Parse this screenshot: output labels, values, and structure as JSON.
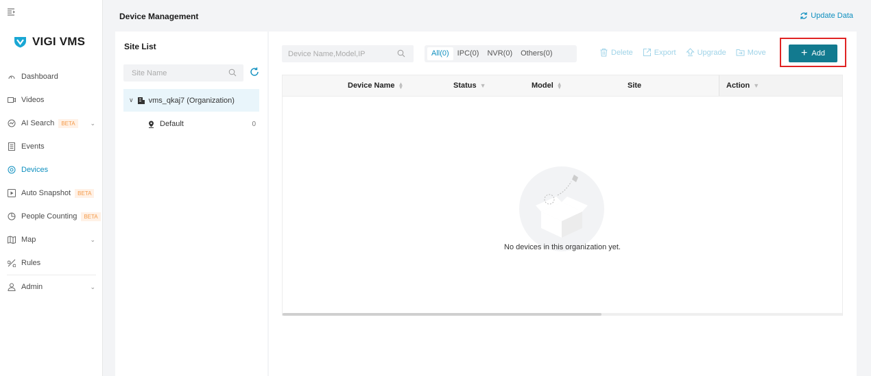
{
  "app": {
    "logo_text": "VIGI VMS"
  },
  "sidebar": {
    "items": [
      {
        "label": "Dashboard",
        "icon": "dashboard-icon"
      },
      {
        "label": "Videos",
        "icon": "video-icon"
      },
      {
        "label": "AI Search",
        "icon": "ai-search-icon",
        "badge": "BETA",
        "expandable": true
      },
      {
        "label": "Events",
        "icon": "events-icon"
      },
      {
        "label": "Devices",
        "icon": "devices-icon",
        "active": true
      },
      {
        "label": "Auto Snapshot",
        "icon": "snapshot-icon",
        "badge": "BETA"
      },
      {
        "label": "People Counting",
        "icon": "people-counting-icon",
        "badge": "BETA"
      },
      {
        "label": "Map",
        "icon": "map-icon",
        "expandable": true
      },
      {
        "label": "Rules",
        "icon": "rules-icon"
      },
      {
        "label": "Admin",
        "icon": "admin-icon",
        "expandable": true
      }
    ]
  },
  "header": {
    "title": "Device Management",
    "update_label": "Update Data"
  },
  "site_list": {
    "title": "Site List",
    "search_placeholder": "Site Name",
    "org_label": "vms_qkaj7 (Organization)",
    "child_label": "Default",
    "child_count": "0"
  },
  "main": {
    "search_placeholder": "Device Name,Model,IP",
    "tabs": [
      "All(0)",
      "IPC(0)",
      "NVR(0)",
      "Others(0)"
    ],
    "active_tab": "All(0)",
    "toolbar": {
      "delete_label": "Delete",
      "export_label": "Export",
      "upgrade_label": "Upgrade",
      "move_label": "Move",
      "add_label": "Add"
    },
    "table": {
      "columns": [
        "Device Name",
        "Status",
        "Model",
        "Site",
        "Action"
      ],
      "empty_text": "No devices in this organization yet."
    }
  },
  "colors": {
    "accent": "#0e8fbf",
    "add_button": "#127a8f",
    "beta_text": "#f49b4a",
    "highlight": "#e02222"
  }
}
